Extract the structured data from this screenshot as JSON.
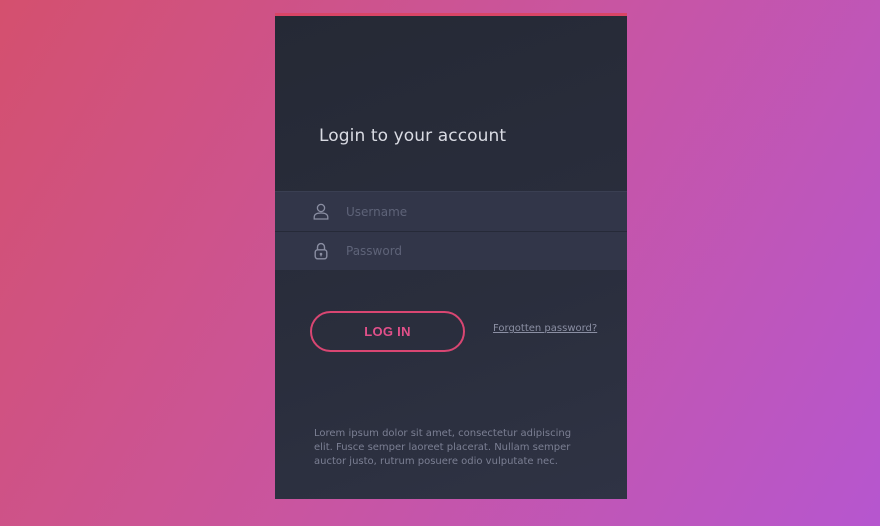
{
  "login_card": {
    "title": "Login to your account",
    "username": {
      "placeholder": "Username",
      "value": "",
      "icon": "user-icon"
    },
    "password": {
      "placeholder": "Password",
      "value": "",
      "icon": "lock-icon"
    },
    "login_button_label": "LOG IN",
    "forgot_link_label": "Forgotten password?",
    "footer_text": "Lorem ipsum dolor sit amet, consectetur adipiscing elit. Fusce semper laoreet placerat. Nullam semper auctor justo, rutrum posuere odio vulputate nec."
  },
  "colors": {
    "background_gradient_start": "#d4506e",
    "background_gradient_end": "#b656cf",
    "card_background": "#2a2e3d",
    "accent": "#d94672",
    "input_band": "#323649"
  }
}
